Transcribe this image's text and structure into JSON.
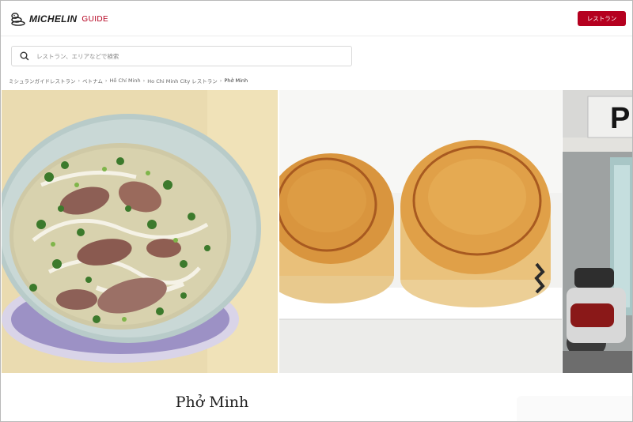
{
  "header": {
    "logo_brand": "MICHELIN",
    "logo_sub": "GUIDE",
    "restaurant_button": "レストラン",
    "accent_color": "#b5001f"
  },
  "search": {
    "placeholder": "レストラン、エリアなどで検索",
    "value": ""
  },
  "breadcrumb": [
    "ミシュランガイドレストラン",
    "ベトナム",
    "Hồ Chí Minh",
    "Ho Chi Minh City レストラン",
    "Phở Minh"
  ],
  "gallery": {
    "photos": [
      "pho-bowl",
      "pate-chaud-pastries",
      "storefront-with-scooter"
    ],
    "sign_text": "P"
  },
  "restaurant": {
    "name": "Phở Minh"
  }
}
